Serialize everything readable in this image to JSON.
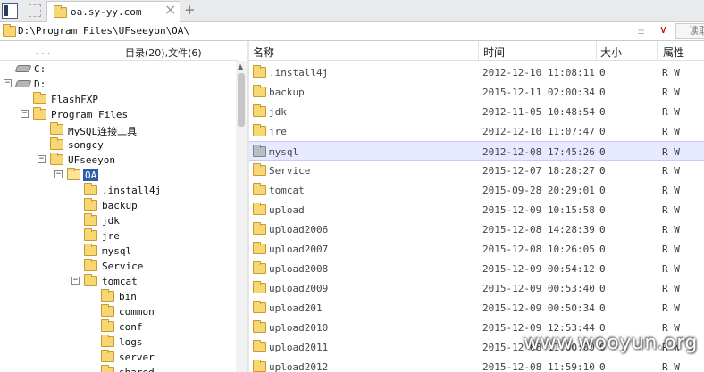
{
  "tabbar": {
    "tab_title": "oa.sy-yy.com",
    "close_glyph": "×",
    "add_glyph": "+"
  },
  "address": {
    "path": "D:\\Program Files\\UFseeyon\\OA\\",
    "sep_glyph": "±",
    "drop_glyph": "∨",
    "read_label": "读取"
  },
  "tree_header": {
    "dots": "...",
    "summary": "目录(20),文件(6)"
  },
  "tree": [
    {
      "label": "C:",
      "type": "drive",
      "indent": 0,
      "exp": ""
    },
    {
      "label": "D:",
      "type": "drive",
      "indent": 0,
      "exp": "−"
    },
    {
      "label": "FlashFXP",
      "type": "folder",
      "indent": 1,
      "exp": ""
    },
    {
      "label": "Program Files",
      "type": "folder",
      "indent": 1,
      "exp": "−"
    },
    {
      "label": "MySQL连接工具",
      "type": "folder",
      "indent": 2,
      "exp": ""
    },
    {
      "label": "songcy",
      "type": "folder",
      "indent": 2,
      "exp": ""
    },
    {
      "label": "UFseeyon",
      "type": "folder",
      "indent": 2,
      "exp": "−"
    },
    {
      "label": "OA",
      "type": "folder-open",
      "indent": 3,
      "exp": "−",
      "selected": true
    },
    {
      "label": ".install4j",
      "type": "folder",
      "indent": 4,
      "exp": ""
    },
    {
      "label": "backup",
      "type": "folder",
      "indent": 4,
      "exp": ""
    },
    {
      "label": "jdk",
      "type": "folder",
      "indent": 4,
      "exp": ""
    },
    {
      "label": "jre",
      "type": "folder",
      "indent": 4,
      "exp": ""
    },
    {
      "label": "mysql",
      "type": "folder",
      "indent": 4,
      "exp": ""
    },
    {
      "label": "Service",
      "type": "folder",
      "indent": 4,
      "exp": ""
    },
    {
      "label": "tomcat",
      "type": "folder",
      "indent": 4,
      "exp": "−"
    },
    {
      "label": "bin",
      "type": "folder",
      "indent": 5,
      "exp": ""
    },
    {
      "label": "common",
      "type": "folder",
      "indent": 5,
      "exp": ""
    },
    {
      "label": "conf",
      "type": "folder",
      "indent": 5,
      "exp": ""
    },
    {
      "label": "logs",
      "type": "folder",
      "indent": 5,
      "exp": ""
    },
    {
      "label": "server",
      "type": "folder",
      "indent": 5,
      "exp": ""
    },
    {
      "label": "shared",
      "type": "folder",
      "indent": 5,
      "exp": ""
    }
  ],
  "columns": {
    "name": "名称",
    "time": "时间",
    "size": "大小",
    "attr": "属性"
  },
  "files": [
    {
      "name": ".install4j",
      "time": "2012-12-10 11:08:11",
      "size": "0",
      "attr": "R W"
    },
    {
      "name": "backup",
      "time": "2015-12-11 02:00:34",
      "size": "0",
      "attr": "R W"
    },
    {
      "name": "jdk",
      "time": "2012-11-05 10:48:54",
      "size": "0",
      "attr": "R W"
    },
    {
      "name": "jre",
      "time": "2012-12-10 11:07:47",
      "size": "0",
      "attr": "R W"
    },
    {
      "name": "mysql",
      "time": "2012-12-08 17:45:26",
      "size": "0",
      "attr": "R W",
      "selected": true
    },
    {
      "name": "Service",
      "time": "2015-12-07 18:28:27",
      "size": "0",
      "attr": "R W"
    },
    {
      "name": "tomcat",
      "time": "2015-09-28 20:29:01",
      "size": "0",
      "attr": "R W"
    },
    {
      "name": "upload",
      "time": "2015-12-09 10:15:58",
      "size": "0",
      "attr": "R W"
    },
    {
      "name": "upload2006",
      "time": "2015-12-08 14:28:39",
      "size": "0",
      "attr": "R W"
    },
    {
      "name": "upload2007",
      "time": "2015-12-08 10:26:05",
      "size": "0",
      "attr": "R W"
    },
    {
      "name": "upload2008",
      "time": "2015-12-09 00:54:12",
      "size": "0",
      "attr": "R W"
    },
    {
      "name": "upload2009",
      "time": "2015-12-09 00:53:40",
      "size": "0",
      "attr": "R W"
    },
    {
      "name": "upload201",
      "time": "2015-12-09 00:50:34",
      "size": "0",
      "attr": "R W"
    },
    {
      "name": "upload2010",
      "time": "2015-12-09 12:53:44",
      "size": "0",
      "attr": "R W"
    },
    {
      "name": "upload2011",
      "time": "2015-12-08 11:00:00",
      "size": "0",
      "attr": "R W"
    },
    {
      "name": "upload2012",
      "time": "2015-12-08 11:59:10",
      "size": "0",
      "attr": "R W"
    }
  ],
  "watermark": "www.wooyun.org"
}
